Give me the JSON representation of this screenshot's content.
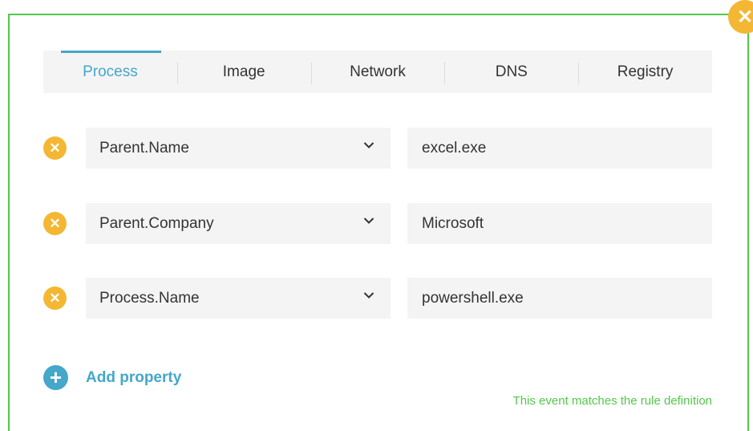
{
  "dialog": {
    "close_icon": "close-icon",
    "close_glyph": "✕"
  },
  "tabs": [
    {
      "label": "Process",
      "active": true
    },
    {
      "label": "Image",
      "active": false
    },
    {
      "label": "Network",
      "active": false
    },
    {
      "label": "DNS",
      "active": false
    },
    {
      "label": "Registry",
      "active": false
    }
  ],
  "conditions": [
    {
      "property": "Parent.Name",
      "value": "excel.exe"
    },
    {
      "property": "Parent.Company",
      "value": "Microsoft"
    },
    {
      "property": "Process.Name",
      "value": "powershell.exe"
    }
  ],
  "add_property": {
    "label": "Add property",
    "icon": "plus-circle-icon"
  },
  "status": {
    "text": "This event matches the rule definition",
    "color": "#52c84a"
  },
  "colors": {
    "accent": "#45a7c9",
    "warning": "#f4b733",
    "success": "#52c84a"
  }
}
